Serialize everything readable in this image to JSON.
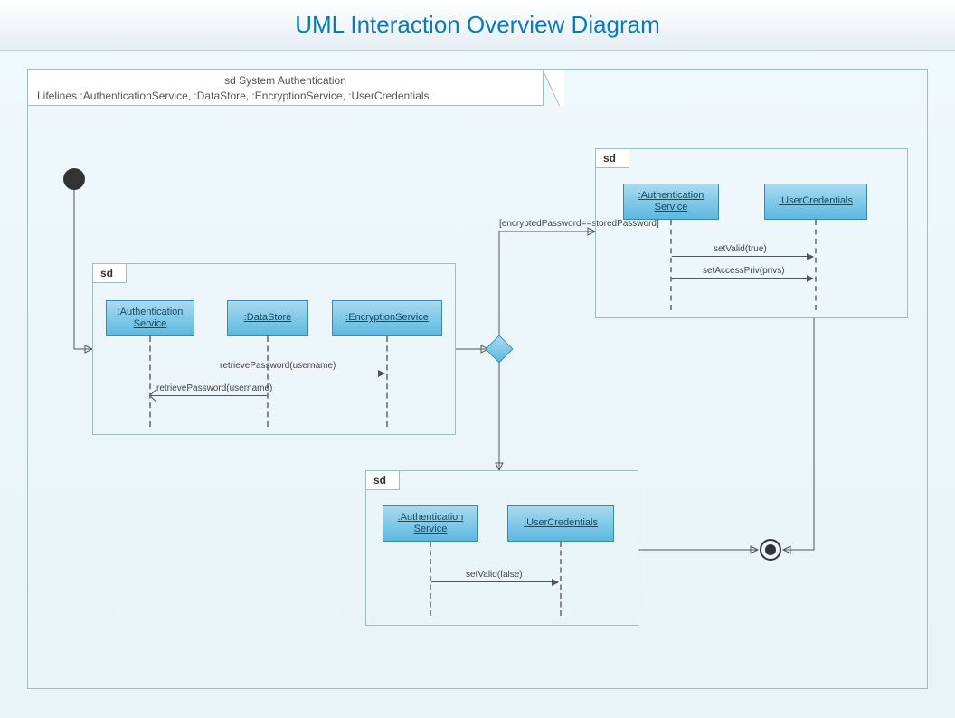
{
  "title": "UML Interaction Overview Diagram",
  "outer": {
    "line1": "sd System Authentication",
    "line2": "Lifelines :AuthenticationService, :DataStore, :EncryptionService, :UserCredentials"
  },
  "guard": "[encryptedPassword==storedPassword]",
  "sd_label": "sd",
  "sd1": {
    "boxes": {
      "auth": ":Authentication Service",
      "ds": ":DataStore",
      "enc": ":EncryptionService"
    },
    "msg1": "retrievePassword(username)",
    "msg2": "retrievePassword(username)"
  },
  "sd2": {
    "boxes": {
      "auth": ":Authentication Service",
      "uc": ":UserCredentials"
    },
    "msg1": "setValid(true)",
    "msg2": "setAccessPriv(privs)"
  },
  "sd3": {
    "boxes": {
      "auth": ":Authentication Service",
      "uc": ":UserCredentials"
    },
    "msg1": "setValid(false)"
  }
}
